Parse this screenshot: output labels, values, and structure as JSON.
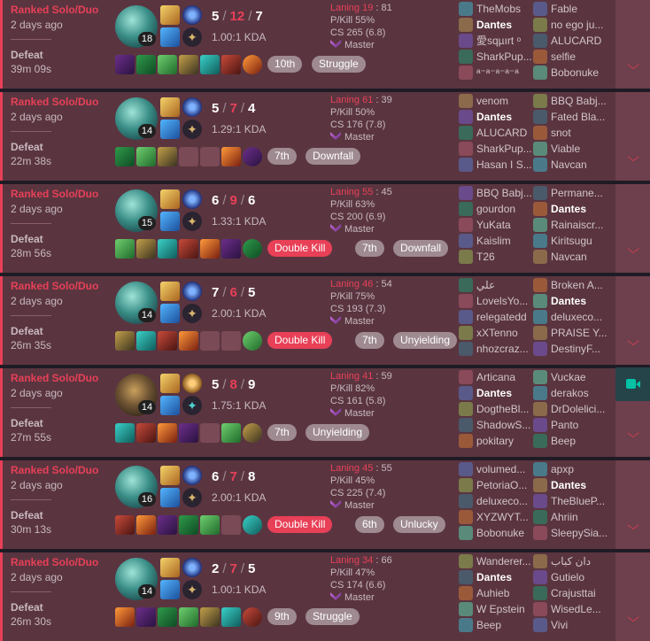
{
  "colors": {
    "defeat": "#e84057",
    "card_bg": "#5a3540",
    "expand_bg": "#6e3f4c",
    "neutral_badge": "#9e8a90",
    "record": "#00c3a5"
  },
  "matches": [
    {
      "queue": "Ranked Solo/Duo",
      "ago": "2 days ago",
      "result": "Defeat",
      "duration": "39m 09s",
      "level": "18",
      "kills": "5",
      "deaths": "12",
      "assists": "7",
      "ratio": "1.00:1 KDA",
      "laning": "Laning 19",
      "laning_opp": ": 81",
      "pkill": "P/Kill 55%",
      "cs": "CS 265 (6.8)",
      "tier": "Master",
      "rune_keystone": "domination",
      "badges": [
        {
          "text": "10th",
          "kind": "place"
        },
        {
          "text": "Struggle",
          "kind": "tag"
        }
      ],
      "items_empty": [],
      "blue": [
        "TheMobs",
        "Dantes",
        "愛sqµırt ᵒ",
        "SharkPup...",
        "ᵃ⁻ᵃ⁻ᵃ⁻ᵃ⁻ᵃ"
      ],
      "red": [
        "Fable",
        "no ego ju...",
        "ALUCARD",
        "selfie",
        "Bobonuke"
      ],
      "me": "blue1"
    },
    {
      "queue": "Ranked Solo/Duo",
      "ago": "2 days ago",
      "result": "Defeat",
      "duration": "22m 38s",
      "level": "14",
      "kills": "5",
      "deaths": "7",
      "assists": "4",
      "ratio": "1.29:1 KDA",
      "laning": "Laning 61",
      "laning_opp": ": 39",
      "pkill": "P/Kill 50%",
      "cs": "CS 176 (7.8)",
      "tier": "Master",
      "rune_keystone": "domination",
      "badges": [
        {
          "text": "7th",
          "kind": "place"
        },
        {
          "text": "Downfall",
          "kind": "tag"
        }
      ],
      "items_empty": [
        3,
        4
      ],
      "blue": [
        "venom",
        "Dantes",
        "ALUCARD",
        "SharkPup...",
        "Hasan I S..."
      ],
      "red": [
        "BBQ Babj...",
        "Fated Bla...",
        "snot",
        "Viable",
        "Navcan"
      ],
      "me": "blue1"
    },
    {
      "queue": "Ranked Solo/Duo",
      "ago": "2 days ago",
      "result": "Defeat",
      "duration": "28m 56s",
      "level": "15",
      "kills": "6",
      "deaths": "9",
      "assists": "6",
      "ratio": "1.33:1 KDA",
      "laning": "Laning 55",
      "laning_opp": ": 45",
      "pkill": "P/Kill 63%",
      "cs": "CS 200 (6.9)",
      "tier": "Master",
      "rune_keystone": "domination",
      "badges": [
        {
          "text": "Double Kill",
          "kind": "mvp"
        },
        {
          "text": "7th",
          "kind": "place"
        },
        {
          "text": "Downfall",
          "kind": "tag"
        }
      ],
      "items_empty": [],
      "blue": [
        "BBQ Babj...",
        "gourdon",
        "YuKata",
        "Kaislim",
        "T26"
      ],
      "red": [
        "Permane...",
        "Dantes",
        "Rainaiscr...",
        "Kiritsugu",
        "Navcan"
      ],
      "me": "red1"
    },
    {
      "queue": "Ranked Solo/Duo",
      "ago": "2 days ago",
      "result": "Defeat",
      "duration": "26m 35s",
      "level": "14",
      "kills": "7",
      "deaths": "6",
      "assists": "5",
      "ratio": "2.00:1 KDA",
      "laning": "Laning 46",
      "laning_opp": ": 54",
      "pkill": "P/Kill 75%",
      "cs": "CS 193 (7.3)",
      "tier": "Master",
      "rune_keystone": "domination",
      "badges": [
        {
          "text": "Double Kill",
          "kind": "mvp"
        },
        {
          "text": "7th",
          "kind": "place"
        },
        {
          "text": "Unyielding",
          "kind": "tag"
        }
      ],
      "items_empty": [
        4,
        5
      ],
      "blue": [
        "علي",
        "LovelsYo...",
        "relegatedd",
        "xXTenno",
        "nhozcraz..."
      ],
      "red": [
        "Broken A...",
        "Dantes",
        "deluxeco...",
        "PRAISE Y...",
        "DestinyF..."
      ],
      "me": "red1"
    },
    {
      "queue": "Ranked Solo/Duo",
      "ago": "2 days ago",
      "result": "Defeat",
      "duration": "27m 55s",
      "level": "14",
      "kills": "5",
      "deaths": "8",
      "assists": "9",
      "ratio": "1.75:1 KDA",
      "laning": "Laning 41",
      "laning_opp": ": 59",
      "pkill": "P/Kill 82%",
      "cs": "CS 161 (5.8)",
      "tier": "Master",
      "rune_keystone": "resolve",
      "badges": [
        {
          "text": "7th",
          "kind": "place"
        },
        {
          "text": "Unyielding",
          "kind": "tag"
        }
      ],
      "items_empty": [
        4
      ],
      "blue": [
        "Articana",
        "Dantes",
        "DogtheBl...",
        "ShadowS...",
        "pokitary"
      ],
      "red": [
        "Vuckae",
        "derakos",
        "DrDolelici...",
        "Panto",
        "Beep"
      ],
      "me": "blue1"
    },
    {
      "queue": "Ranked Solo/Duo",
      "ago": "2 days ago",
      "result": "Defeat",
      "duration": "30m 13s",
      "level": "16",
      "kills": "6",
      "deaths": "7",
      "assists": "8",
      "ratio": "2.00:1 KDA",
      "laning": "Laning 45",
      "laning_opp": ": 55",
      "pkill": "P/Kill 45%",
      "cs": "CS 225 (7.4)",
      "tier": "Master",
      "rune_keystone": "domination",
      "badges": [
        {
          "text": "Double Kill",
          "kind": "mvp"
        },
        {
          "text": "6th",
          "kind": "place"
        },
        {
          "text": "Unlucky",
          "kind": "tag"
        }
      ],
      "items_empty": [
        5
      ],
      "blue": [
        "volumed...",
        "PetoriaO...",
        "deluxeco...",
        "XYZWYT...",
        "Bobonuke"
      ],
      "red": [
        "apxp",
        "Dantes",
        "TheBlueP...",
        "Ahriin",
        "SleepySia..."
      ],
      "me": "red1"
    },
    {
      "queue": "Ranked Solo/Duo",
      "ago": "2 days ago",
      "result": "Defeat",
      "duration": "26m 30s",
      "level": "14",
      "kills": "2",
      "deaths": "7",
      "assists": "5",
      "ratio": "1.00:1 KDA",
      "laning": "Laning 34",
      "laning_opp": ": 66",
      "pkill": "P/Kill 47%",
      "cs": "CS 174 (6.6)",
      "tier": "Master",
      "rune_keystone": "domination",
      "badges": [
        {
          "text": "9th",
          "kind": "place"
        },
        {
          "text": "Struggle",
          "kind": "tag"
        }
      ],
      "items_empty": [],
      "blue": [
        "Wanderer...",
        "Dantes",
        "Auhieb",
        "W Epstein",
        "Beep"
      ],
      "red": [
        "دان كباب",
        "Gutielo",
        "Crajusttai",
        "WisedLe...",
        "Vivi"
      ],
      "me": "blue1"
    }
  ],
  "icons": {
    "expand": "chevron-down-icon",
    "record": "video-camera-icon"
  }
}
